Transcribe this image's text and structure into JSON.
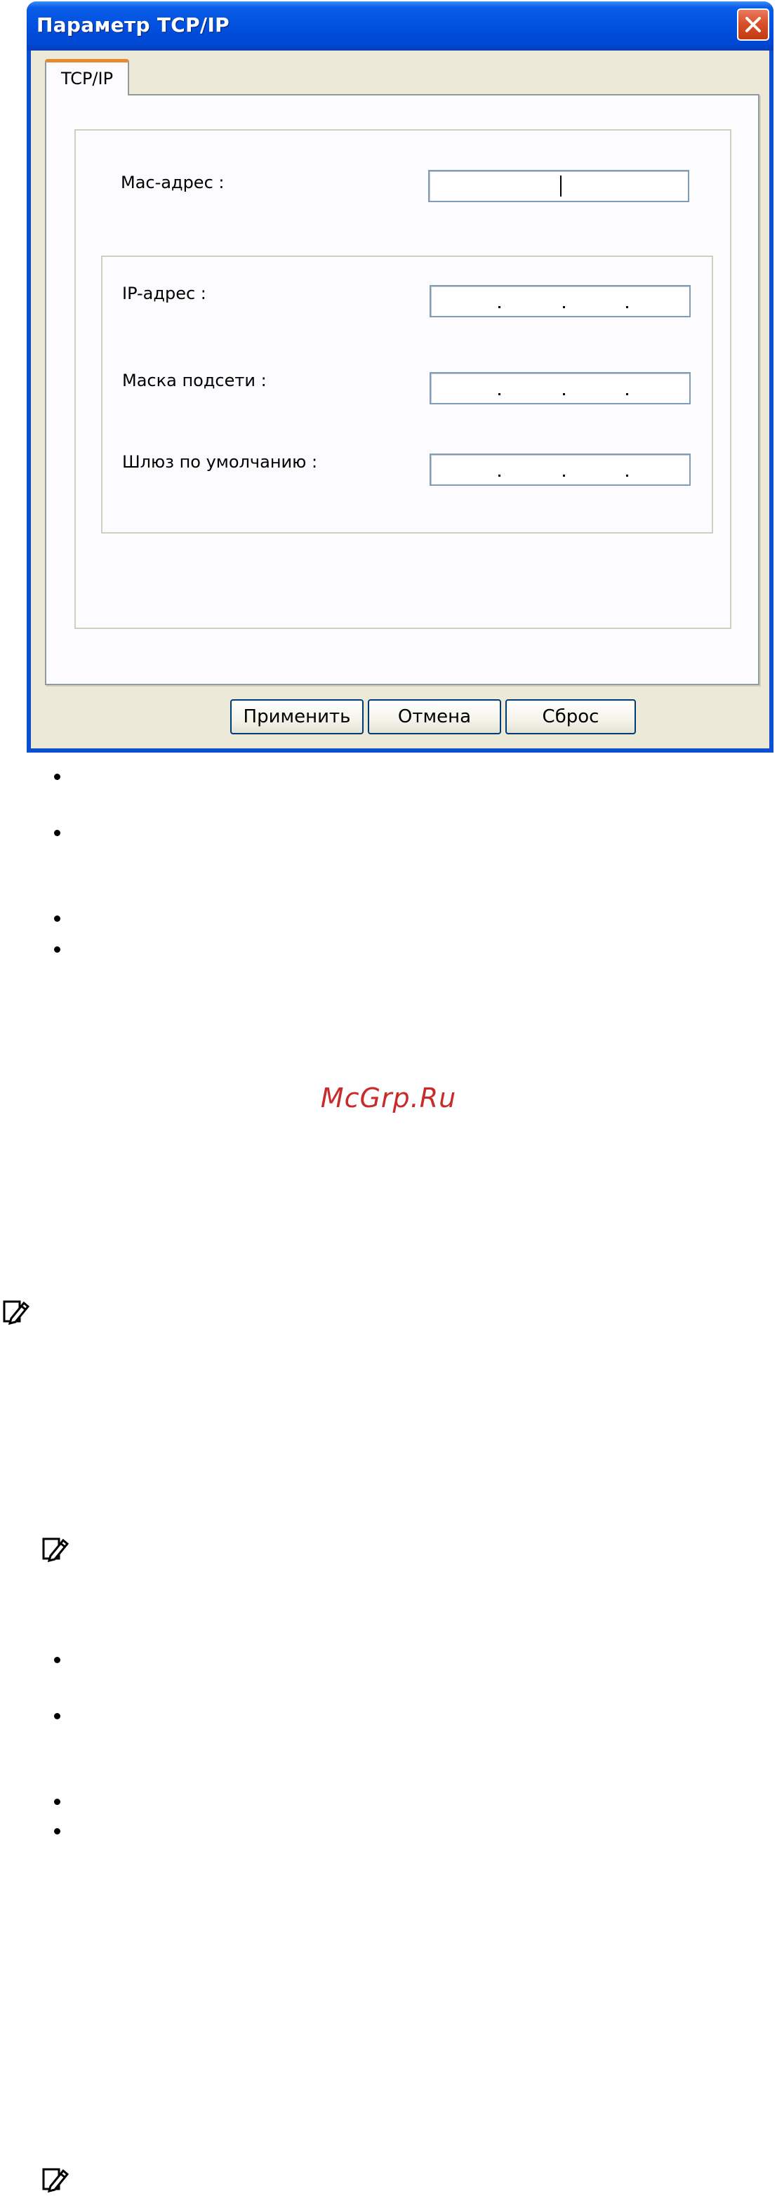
{
  "dialog": {
    "title": "Параметр TCP/IP",
    "tab_label": "TCP/IP",
    "mac_label": "Mac-адрес :",
    "ip_label": "IP-адрес :",
    "mask_label": "Маска подсети :",
    "gateway_label": "Шлюз по умолчанию :",
    "buttons": {
      "apply": "Применить",
      "cancel": "Отмена",
      "reset": "Сброс"
    },
    "colors": {
      "titlebar": "#0150df",
      "close_button": "#d9502a",
      "face": "#ece9d8",
      "tab_highlight": "#e68b2c"
    }
  },
  "page": {
    "watermark": "McGrp.Ru",
    "watermark_color": "#c92a2a",
    "note_icon": "note-pencil-icon"
  }
}
